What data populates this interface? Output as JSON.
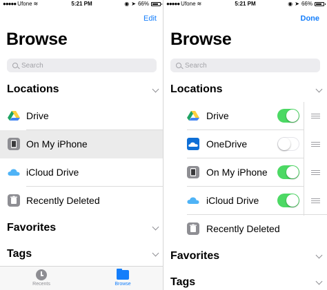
{
  "status": {
    "carrier": "Ufone",
    "time": "5:21 PM",
    "battery": "66%",
    "battery_level": 0.66
  },
  "left": {
    "top_button": "Edit",
    "title": "Browse",
    "search_placeholder": "Search",
    "locations_header": "Locations",
    "locations": [
      {
        "label": "Drive",
        "icon": "google-drive-icon"
      },
      {
        "label": "On My iPhone",
        "icon": "iphone-icon",
        "selected": true
      },
      {
        "label": "iCloud Drive",
        "icon": "icloud-icon"
      },
      {
        "label": "Recently Deleted",
        "icon": "trash-icon"
      }
    ],
    "favorites_header": "Favorites",
    "tags_header": "Tags",
    "tabs": [
      {
        "label": "Recents",
        "icon": "clock-icon"
      },
      {
        "label": "Browse",
        "icon": "folder-icon",
        "active": true
      }
    ]
  },
  "right": {
    "top_button": "Done",
    "title": "Browse",
    "search_placeholder": "Search",
    "locations_header": "Locations",
    "locations": [
      {
        "label": "Drive",
        "icon": "google-drive-icon",
        "enabled": true
      },
      {
        "label": "OneDrive",
        "icon": "onedrive-icon",
        "enabled": false
      },
      {
        "label": "On My iPhone",
        "icon": "iphone-icon",
        "enabled": true
      },
      {
        "label": "iCloud Drive",
        "icon": "icloud-icon",
        "enabled": true
      },
      {
        "label": "Recently Deleted",
        "icon": "trash-icon"
      }
    ],
    "favorites_header": "Favorites",
    "tags_header": "Tags"
  },
  "colors": {
    "accent": "#147efb",
    "toggle_on": "#4cd964",
    "selected_row": "#ebebeb"
  }
}
